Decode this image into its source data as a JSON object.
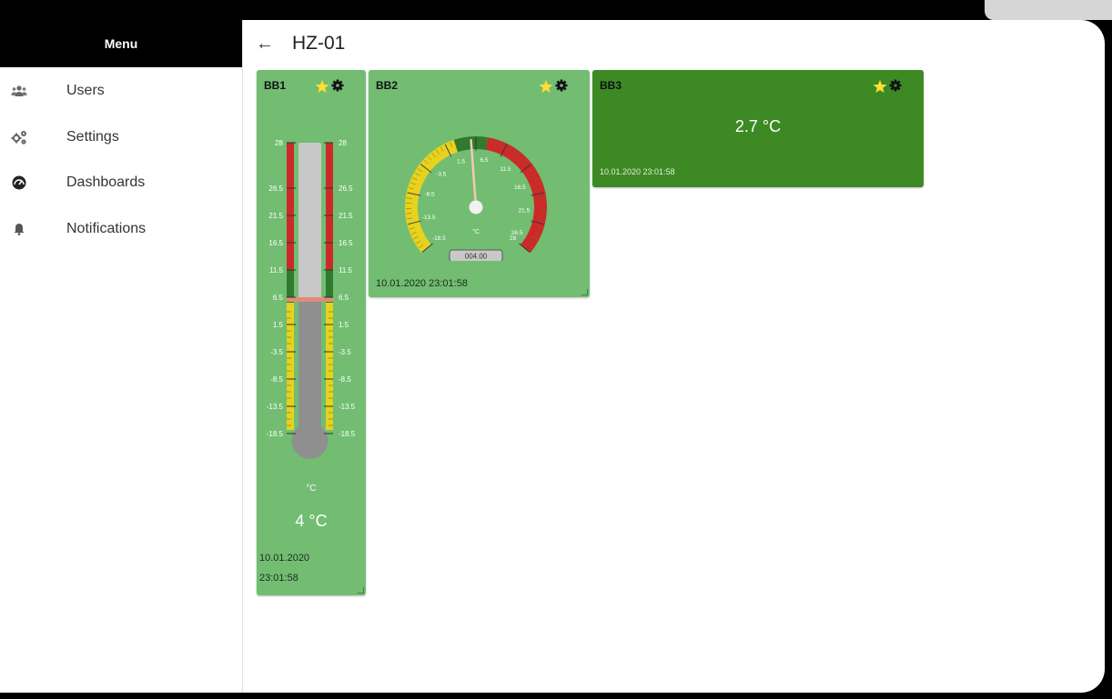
{
  "sidebar": {
    "menu_title": "Menu",
    "items": [
      {
        "label": "Users",
        "icon": "users-icon"
      },
      {
        "label": "Settings",
        "icon": "settings-icon"
      },
      {
        "label": "Dashboards",
        "icon": "dashboard-icon"
      },
      {
        "label": "Notifications",
        "icon": "bell-icon"
      }
    ]
  },
  "header": {
    "back_icon": "arrow-left-icon",
    "title": "HZ-01"
  },
  "colors": {
    "widget_green": "#72bd72",
    "widget_dark_green": "#3d8a24",
    "scale_yellow": "#e6d21f",
    "scale_red": "#cc2a2a",
    "scale_dark_green": "#2f7a2f",
    "star": "#ffe033"
  },
  "widgets": {
    "bb1": {
      "title": "BB1",
      "scale_labels": [
        "28",
        "26.5",
        "21.5",
        "16.5",
        "11.5",
        "6.5",
        "1.5",
        "-3.5",
        "-8.5",
        "-13.5",
        "-18.5"
      ],
      "unit": "°C",
      "value_text": "4 °C",
      "value": 4,
      "date": "10.01.2020",
      "time": "23:01:58"
    },
    "bb2": {
      "title": "BB2",
      "dial_labels": [
        "-18.5",
        "-13.5",
        "-8.5",
        "-3.5",
        "1.5",
        "6.5",
        "11.5",
        "16.5",
        "21.5",
        "26.5",
        "28"
      ],
      "unit": "°C",
      "readout": "004.00",
      "value": 4,
      "timestamp": "10.01.2020 23:01:58"
    },
    "bb3": {
      "title": "BB3",
      "value_text": "2.7 °C",
      "timestamp": "10.01.2020 23:01:58"
    }
  }
}
